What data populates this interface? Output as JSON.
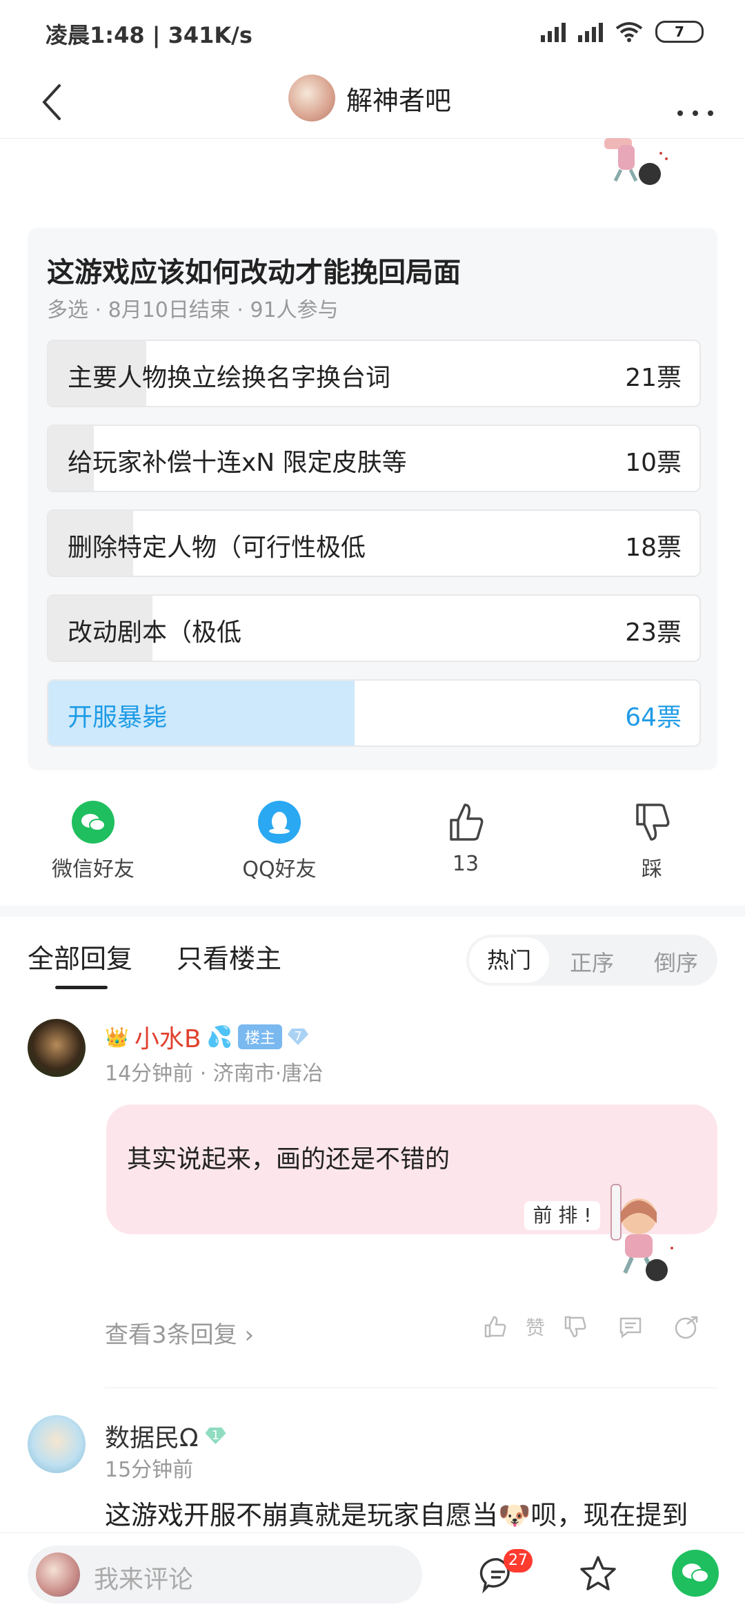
{
  "status_bar": {
    "time": "凌晨1:48 | 341K/s",
    "battery": "7"
  },
  "header": {
    "forum_name": "解神者吧"
  },
  "poll": {
    "title": "这游戏应该如何改动才能挽回局面",
    "meta": "多选 · 8月10日结束 · 91人参与",
    "options": [
      {
        "label": "主要人物换立绘换名字换台词",
        "votes": "21票",
        "share": 0.15,
        "selected": false
      },
      {
        "label": "给玩家补偿十连xN 限定皮肤等",
        "votes": "10票",
        "share": 0.07,
        "selected": false
      },
      {
        "label": "删除特定人物（可行性极低",
        "votes": "18票",
        "share": 0.13,
        "selected": false
      },
      {
        "label": "改动剧本（极低",
        "votes": "23票",
        "share": 0.16,
        "selected": false
      },
      {
        "label": "开服暴毙",
        "votes": "64票",
        "share": 0.47,
        "selected": true
      }
    ]
  },
  "actions": {
    "wechat": "微信好友",
    "qq": "QQ好友",
    "like_count": "13",
    "dislike": "踩"
  },
  "tabs": {
    "all": "全部回复",
    "owner_only": "只看楼主",
    "sort": [
      "热门",
      "正序",
      "倒序"
    ]
  },
  "comment1": {
    "username": "小水B",
    "badge": "楼主",
    "level": "7",
    "meta": "14分钟前 · 济南市·唐冶",
    "text": "其实说起来，画的还是不错的",
    "sticker_text": "前 排 !",
    "view_replies": "查看3条回复",
    "like_label": "赞"
  },
  "comment2": {
    "username": "数据民Ω",
    "level": "1",
    "meta": "15分钟前",
    "text_before": "这游戏开服不崩真就是玩家自愿当",
    "emoji": "🐶",
    "text_after": "呗，现在提到"
  },
  "bottom": {
    "placeholder": "我来评论",
    "badge_count": "27"
  },
  "colors": {
    "accent": "#1f9be6",
    "wechat": "#1fbf5f",
    "qq": "#2aa8f2",
    "username_red": "#e0412f",
    "bubble_pink": "#fde6eb"
  }
}
